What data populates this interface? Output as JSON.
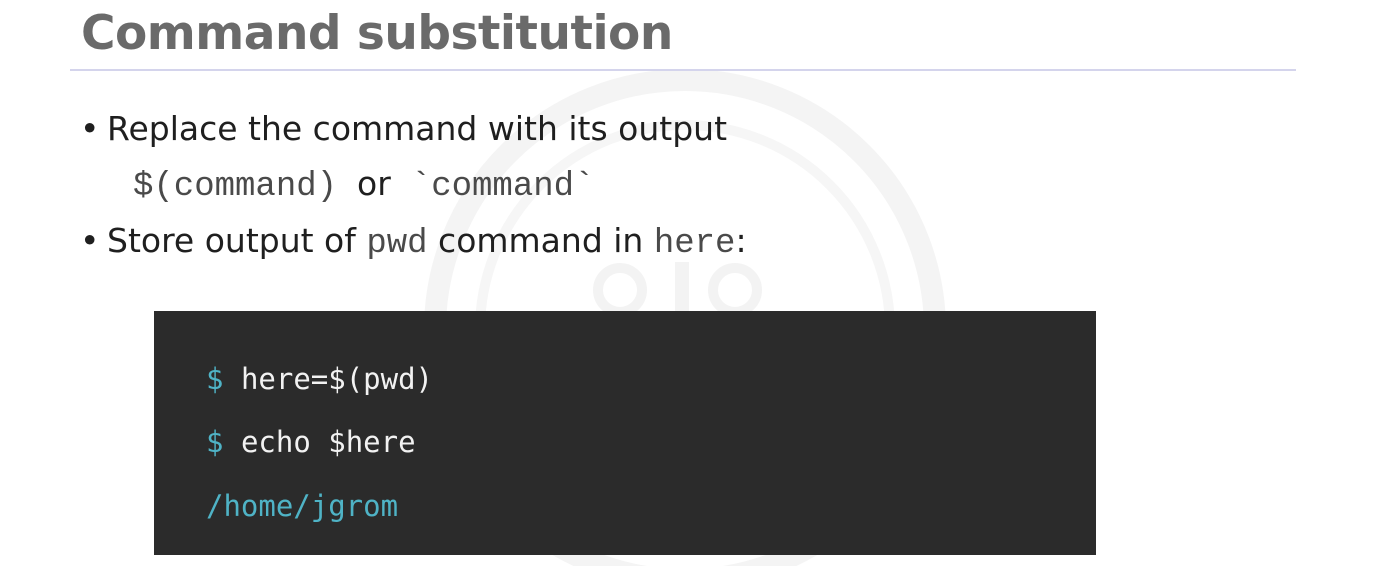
{
  "slide": {
    "title": "Command substitution",
    "bullets": {
      "first": {
        "marker": "•",
        "text": "Replace the command with its output"
      },
      "syntax": {
        "form1": "$(command)",
        "joiner": "or",
        "form2": "`command`"
      },
      "second": {
        "marker": "•",
        "prefix": "Store output of ",
        "cmd": "pwd",
        "middle": " command in ",
        "var": "here",
        "suffix": ":"
      }
    }
  },
  "terminal": {
    "lines": [
      {
        "prompt": "$",
        "command": "here=$(pwd)"
      },
      {
        "prompt": "$",
        "command": "echo $here"
      }
    ],
    "output": "/home/jgrom"
  },
  "colors": {
    "title": "#6a6a6a",
    "rule": "#d4d4ec",
    "terminal_bg": "#2b2b2b",
    "prompt_accent": "#4fb3c6"
  }
}
